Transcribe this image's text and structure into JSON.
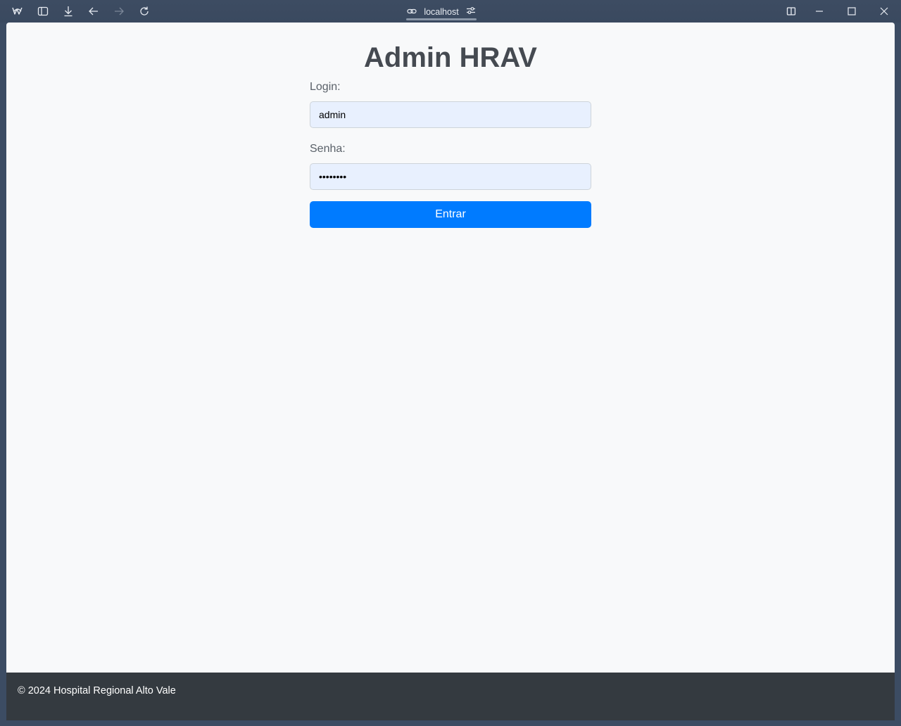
{
  "browser": {
    "address": "localhost",
    "icons": {
      "app": "browser-logo-icon",
      "sidebar": "sidebar-toggle-icon",
      "download": "download-icon",
      "back": "back-arrow-icon",
      "forward": "forward-arrow-icon",
      "reload": "reload-icon",
      "link": "link-icon",
      "site_settings": "sliders-icon",
      "split": "split-view-icon",
      "minimize": "minimize-icon",
      "maximize": "maximize-icon",
      "close": "close-icon"
    }
  },
  "page": {
    "title": "Admin HRAV",
    "login_label": "Login:",
    "login_value": "admin",
    "password_label": "Senha:",
    "password_value": "••••••••",
    "submit_label": "Entrar",
    "footer_text": "© 2024 Hospital Regional Alto Vale"
  },
  "colors": {
    "accent": "#007bff",
    "footer_bg": "#343a40",
    "input_bg": "#e8f0fe",
    "page_bg": "#f8f9fa"
  }
}
